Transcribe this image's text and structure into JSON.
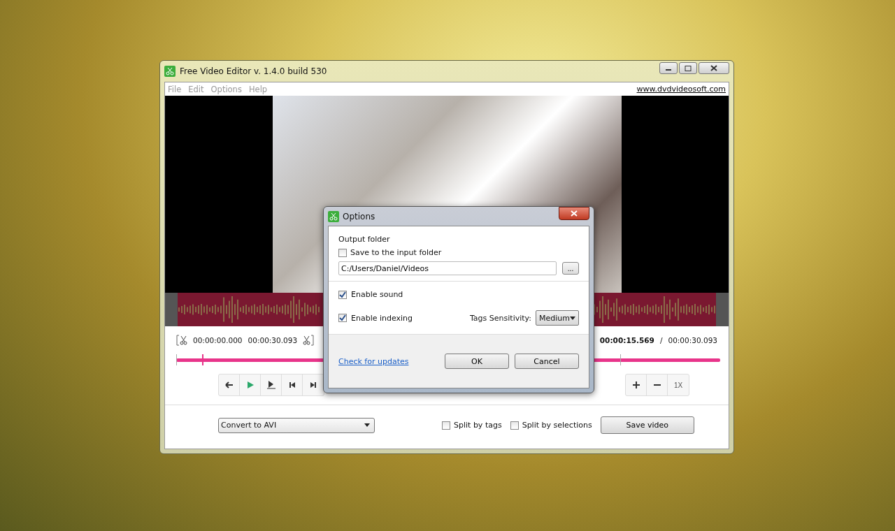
{
  "window": {
    "title": "Free Video Editor v. 1.4.0 build 530"
  },
  "menu": [
    "File",
    "Edit",
    "Options",
    "Help"
  ],
  "website_link": "www.dvdvideosoft.com",
  "selection": {
    "start": "00:00:00.000",
    "end": "00:00:30.093"
  },
  "playback": {
    "current": "00:00:15.569",
    "separator": "/",
    "total": "00:00:30.093"
  },
  "zoom_controls": {
    "speed": "1X"
  },
  "format_dropdown": {
    "value": "Convert to AVI"
  },
  "split_options": [
    {
      "label": "Split by tags",
      "checked": false
    },
    {
      "label": "Split by selections",
      "checked": false
    }
  ],
  "save_button": "Save video",
  "dialog": {
    "title": "Options",
    "section": "Output folder",
    "save_to_input": {
      "label": "Save to the input folder",
      "checked": false
    },
    "folder": {
      "value": "C:/Users/Daniel/Videos"
    },
    "browse": "...",
    "toggles": [
      {
        "label": "Enable sound",
        "checked": true
      },
      {
        "label": "Enable indexing",
        "checked": true
      }
    ],
    "sensitivity": {
      "label": "Tags Sensitivity:",
      "value": "Medium"
    },
    "link": "Check for updates",
    "buttons": [
      "OK",
      "Cancel"
    ]
  }
}
